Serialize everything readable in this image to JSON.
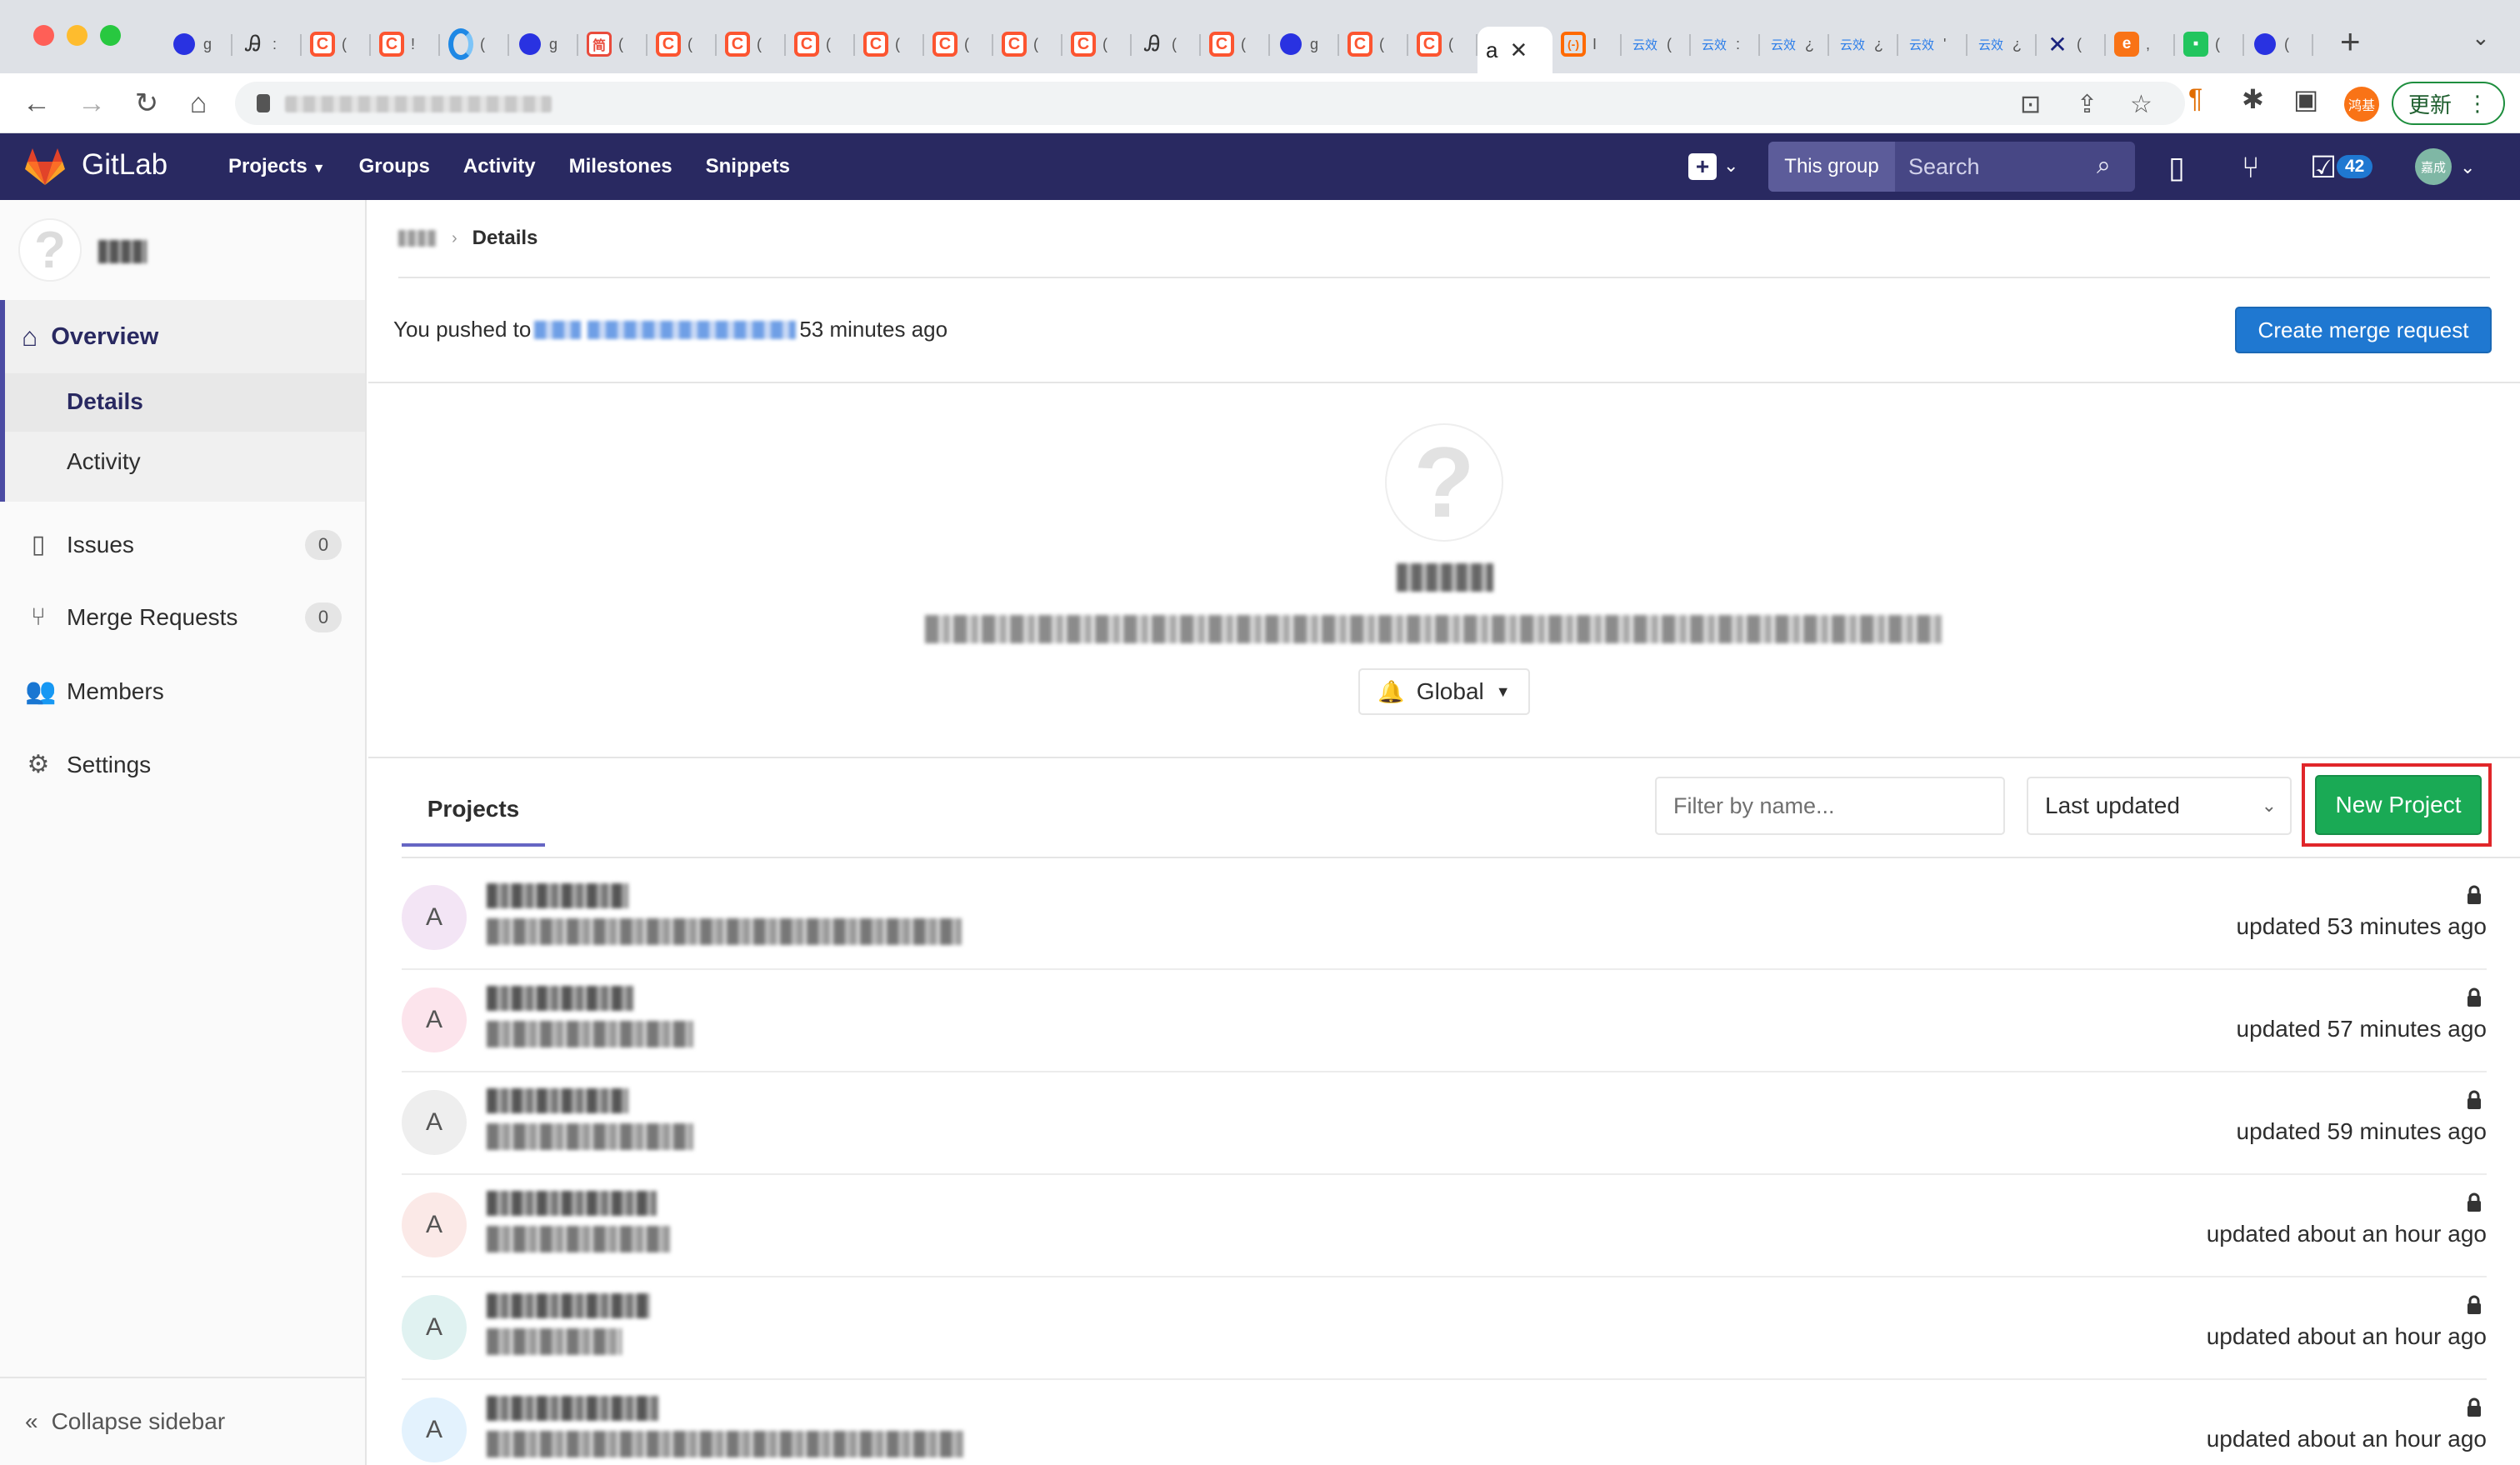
{
  "browser": {
    "tabs": [
      {
        "icon": "baidu-icon",
        "label": "g"
      },
      {
        "icon": "hand-icon",
        "label": ":"
      },
      {
        "icon": "csdn-icon",
        "label": "("
      },
      {
        "icon": "csdn-icon",
        "label": "!"
      },
      {
        "icon": "bing-icon",
        "label": "("
      },
      {
        "icon": "baidu-icon",
        "label": "g"
      },
      {
        "icon": "jianshu-icon",
        "label": "("
      },
      {
        "icon": "csdn-icon",
        "label": "("
      },
      {
        "icon": "csdn-icon",
        "label": "("
      },
      {
        "icon": "csdn-icon",
        "label": "("
      },
      {
        "icon": "csdn-icon",
        "label": "("
      },
      {
        "icon": "csdn-icon",
        "label": "("
      },
      {
        "icon": "csdn-icon",
        "label": "("
      },
      {
        "icon": "csdn-icon",
        "label": "("
      },
      {
        "icon": "hand-icon",
        "label": "("
      },
      {
        "icon": "csdn-icon",
        "label": "("
      },
      {
        "icon": "baidu-icon",
        "label": "g"
      },
      {
        "icon": "csdn-icon",
        "label": "("
      },
      {
        "icon": "csdn-icon",
        "label": "("
      }
    ],
    "active_tab": {
      "label": "a"
    },
    "tabs_right": [
      {
        "icon": "aliyun-icon",
        "label": "I"
      },
      {
        "icon": "yunxiao-icon",
        "label": "("
      },
      {
        "icon": "yunxiao-icon",
        "label": ":"
      },
      {
        "icon": "yunxiao-icon",
        "label": "¿"
      },
      {
        "icon": "yunxiao-icon",
        "label": "¿"
      },
      {
        "icon": "yunxiao-icon",
        "label": "'"
      },
      {
        "icon": "yunxiao-icon",
        "label": "¿"
      },
      {
        "icon": "x-icon",
        "label": "("
      },
      {
        "icon": "orange-icon",
        "label": ","
      },
      {
        "icon": "green-icon",
        "label": "("
      },
      {
        "icon": "baidu-icon",
        "label": "("
      }
    ],
    "ext_avatar_label": "鸿基",
    "update_label": "更新"
  },
  "gitlab": {
    "brand": "GitLab",
    "nav": {
      "projects": "Projects",
      "groups": "Groups",
      "activity": "Activity",
      "milestones": "Milestones",
      "snippets": "Snippets"
    },
    "search": {
      "scope": "This group",
      "placeholder": "Search"
    },
    "todo_count": "42",
    "user_avatar_label": "嘉成"
  },
  "sidebar": {
    "overview": "Overview",
    "details": "Details",
    "activity": "Activity",
    "issues": {
      "label": "Issues",
      "count": "0"
    },
    "merge_requests": {
      "label": "Merge Requests",
      "count": "0"
    },
    "members": "Members",
    "settings": "Settings",
    "collapse": "Collapse sidebar"
  },
  "main": {
    "breadcrumb_current": "Details",
    "push_prefix": "You pushed to",
    "push_suffix": "53 minutes ago",
    "create_mr": "Create merge request",
    "notification": "Global",
    "projects_tab": "Projects",
    "filter_placeholder": "Filter by name...",
    "sort_label": "Last updated",
    "new_project": "New Project",
    "projects": [
      {
        "initial": "A",
        "updated": "updated 53 minutes ago",
        "color": "#f3e5f5"
      },
      {
        "initial": "A",
        "updated": "updated 57 minutes ago",
        "color": "#fce4ec"
      },
      {
        "initial": "A",
        "updated": "updated 59 minutes ago",
        "color": "#eeeeee"
      },
      {
        "initial": "A",
        "updated": "updated about an hour ago",
        "color": "#fbe9e7"
      },
      {
        "initial": "A",
        "updated": "updated about an hour ago",
        "color": "#e0f2f1"
      },
      {
        "initial": "A",
        "updated": "updated about an hour ago",
        "color": "#e3f2fd"
      }
    ]
  },
  "colors": {
    "header_bg": "#292961",
    "primary_blue": "#1f78d1",
    "success_green": "#1aaa55",
    "highlight_red": "#e0262a"
  }
}
